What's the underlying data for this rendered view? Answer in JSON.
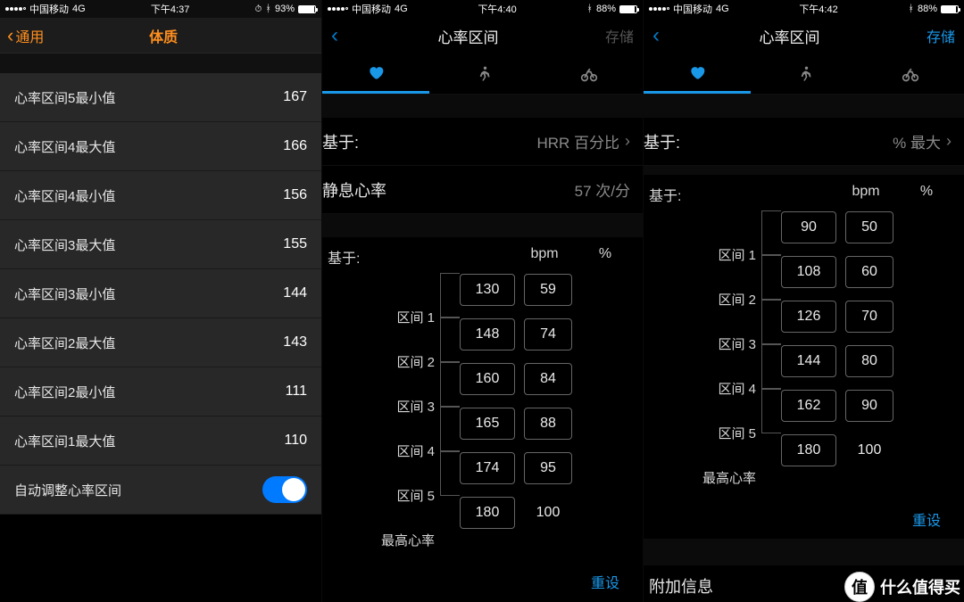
{
  "screen1": {
    "status": {
      "carrier": "中国移动",
      "network": "4G",
      "time": "下午4:37",
      "battery_pct": "93%",
      "battery_fill": 93
    },
    "nav": {
      "back": "通用",
      "title": "体质"
    },
    "rows": [
      {
        "label": "心率区间5最小值",
        "value": "167"
      },
      {
        "label": "心率区间4最大值",
        "value": "166"
      },
      {
        "label": "心率区间4最小值",
        "value": "156"
      },
      {
        "label": "心率区间3最大值",
        "value": "155"
      },
      {
        "label": "心率区间3最小值",
        "value": "144"
      },
      {
        "label": "心率区间2最大值",
        "value": "143"
      },
      {
        "label": "心率区间2最小值",
        "value": "111"
      },
      {
        "label": "心率区间1最大值",
        "value": "110"
      }
    ],
    "toggle": {
      "label": "自动调整心率区间",
      "on": true
    }
  },
  "screen2": {
    "status": {
      "carrier": "中国移动",
      "network": "4G",
      "time": "下午4:40",
      "battery_pct": "88%",
      "battery_fill": 88
    },
    "nav": {
      "title": "心率区间",
      "save": "存储",
      "save_enabled": false
    },
    "based_on": {
      "label": "基于:",
      "value": "HRR 百分比"
    },
    "resting": {
      "label": "静息心率",
      "value": "57 次/分"
    },
    "zone_header": {
      "label": "基于:",
      "bpm": "bpm",
      "pct": "%"
    },
    "zones": {
      "labels": [
        "区间 1",
        "区间 2",
        "区间 3",
        "区间 4",
        "区间 5",
        "最高心率"
      ],
      "bpm": [
        "130",
        "148",
        "160",
        "165",
        "174",
        "180"
      ],
      "pct": [
        "59",
        "74",
        "84",
        "88",
        "95",
        "100"
      ],
      "pct_boxed": [
        true,
        true,
        true,
        true,
        true,
        false
      ]
    },
    "reset": "重设"
  },
  "screen3": {
    "status": {
      "carrier": "中国移动",
      "network": "4G",
      "time": "下午4:42",
      "battery_pct": "88%",
      "battery_fill": 88
    },
    "nav": {
      "title": "心率区间",
      "save": "存储",
      "save_enabled": true
    },
    "based_on": {
      "label": "基于:",
      "value": "% 最大"
    },
    "zone_header": {
      "label": "基于:",
      "bpm": "bpm",
      "pct": "%"
    },
    "zones": {
      "labels": [
        "区间 1",
        "区间 2",
        "区间 3",
        "区间 4",
        "区间 5",
        "最高心率"
      ],
      "bpm": [
        "90",
        "108",
        "126",
        "144",
        "162",
        "180"
      ],
      "pct": [
        "50",
        "60",
        "70",
        "80",
        "90",
        "100"
      ],
      "pct_boxed": [
        true,
        true,
        true,
        true,
        true,
        false
      ]
    },
    "reset": "重设",
    "extra": "附加信息"
  },
  "watermark": {
    "badge": "值",
    "text": "什么值得买"
  }
}
